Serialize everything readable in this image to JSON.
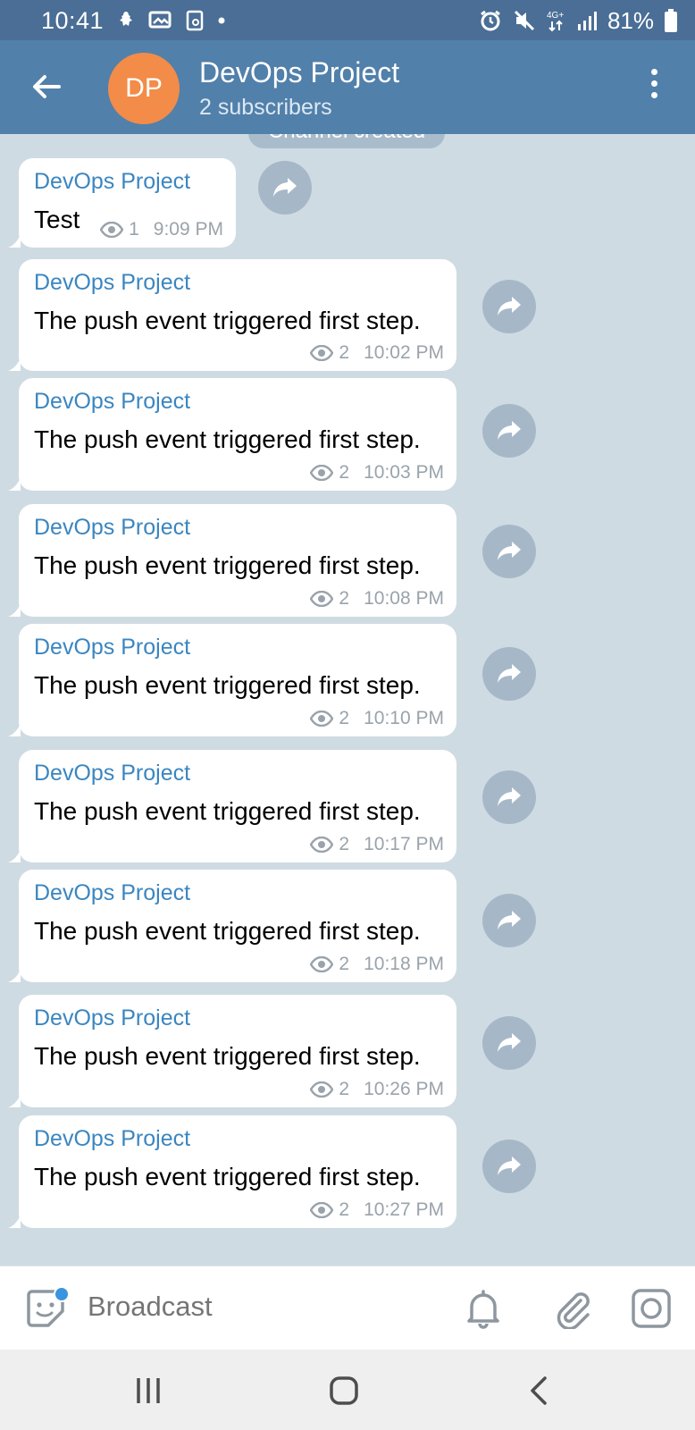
{
  "status_bar": {
    "time": "10:41",
    "battery": "81%"
  },
  "header": {
    "avatar_initials": "DP",
    "title": "DevOps Project",
    "subtitle": "2 subscribers"
  },
  "service_message": "Channel created",
  "messages": [
    {
      "sender": "DevOps Project",
      "text": "Test",
      "views": "1",
      "time": "9:09 PM"
    },
    {
      "sender": "DevOps Project",
      "text": "The push event triggered first step.",
      "views": "2",
      "time": "10:02 PM"
    },
    {
      "sender": "DevOps Project",
      "text": "The push event triggered first step.",
      "views": "2",
      "time": "10:03 PM"
    },
    {
      "sender": "DevOps Project",
      "text": "The push event triggered first step.",
      "views": "2",
      "time": "10:08 PM"
    },
    {
      "sender": "DevOps Project",
      "text": "The push event triggered first step.",
      "views": "2",
      "time": "10:10 PM"
    },
    {
      "sender": "DevOps Project",
      "text": "The push event triggered first step.",
      "views": "2",
      "time": "10:17 PM"
    },
    {
      "sender": "DevOps Project",
      "text": "The push event triggered first step.",
      "views": "2",
      "time": "10:18 PM"
    },
    {
      "sender": "DevOps Project",
      "text": "The push event triggered first step.",
      "views": "2",
      "time": "10:26 PM"
    },
    {
      "sender": "DevOps Project",
      "text": "The push event triggered first step.",
      "views": "2",
      "time": "10:27 PM"
    }
  ],
  "input": {
    "placeholder": "Broadcast"
  },
  "colors": {
    "header": "#5180aa",
    "status_bar": "#4a6e95",
    "avatar": "#f28c48",
    "sender_name": "#3b86c0",
    "chat_background": "#cfdbe3"
  },
  "icons": {
    "back": "arrow-left-icon",
    "menu": "more-vertical-icon",
    "share": "share-arrow-icon",
    "views": "eye-icon",
    "emoji": "sticker-icon",
    "mute": "bell-icon",
    "attach": "paperclip-icon",
    "camera": "camera-icon"
  }
}
